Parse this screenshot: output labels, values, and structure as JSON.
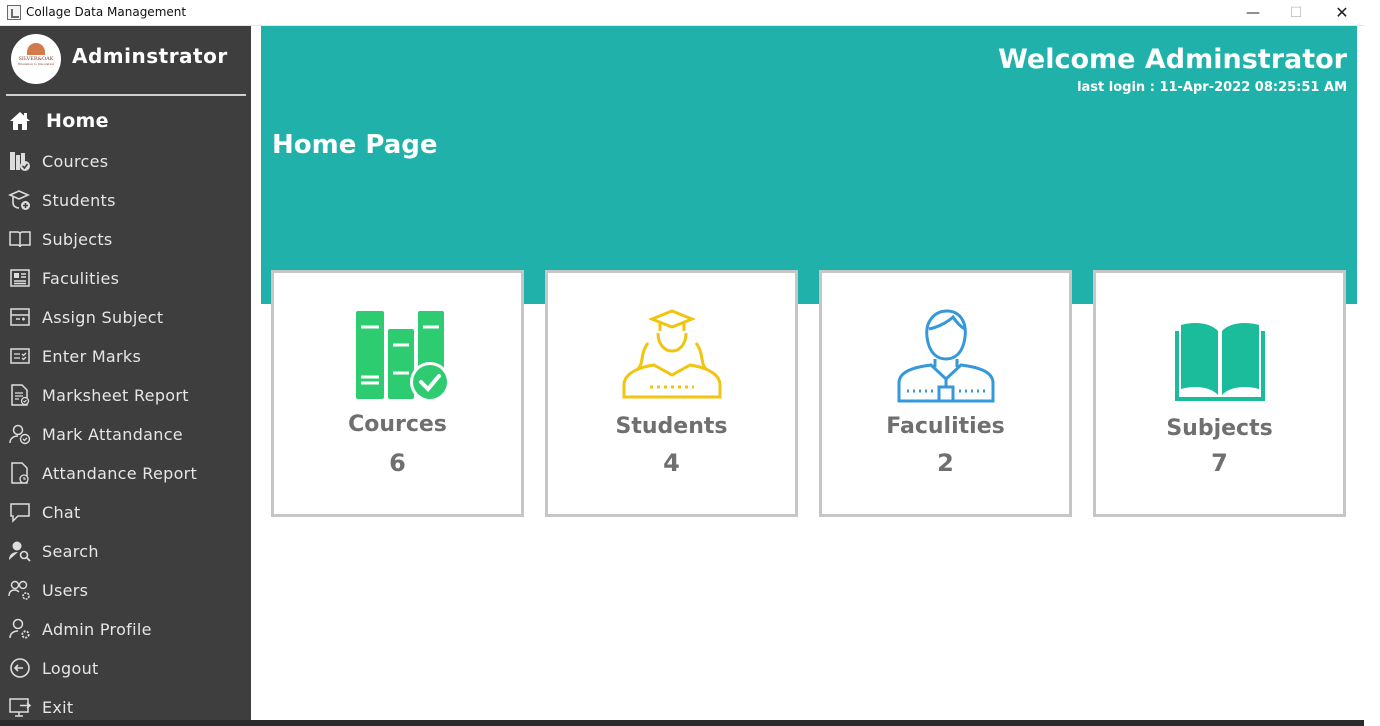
{
  "window": {
    "title": "Collage Data Management",
    "minimize": "—",
    "maximize": "☐",
    "close": "✕"
  },
  "logo": {
    "line1": "SILVER&OAK",
    "line2": "Education to Innovation"
  },
  "sidebar": {
    "title": "Adminstrator",
    "items": [
      {
        "label": "Home",
        "icon": "home-icon"
      },
      {
        "label": "Cources",
        "icon": "books-check-icon"
      },
      {
        "label": "Students",
        "icon": "student-add-icon"
      },
      {
        "label": "Subjects",
        "icon": "open-book-icon"
      },
      {
        "label": "Faculities",
        "icon": "id-card-icon"
      },
      {
        "label": "Assign Subject",
        "icon": "assign-icon"
      },
      {
        "label": "Enter Marks",
        "icon": "checklist-icon"
      },
      {
        "label": "Marksheet Report",
        "icon": "report-icon"
      },
      {
        "label": "Mark Attandance",
        "icon": "user-check-icon"
      },
      {
        "label": "Attandance Report",
        "icon": "document-clock-icon"
      },
      {
        "label": "Chat",
        "icon": "chat-icon"
      },
      {
        "label": "Search",
        "icon": "user-search-icon"
      },
      {
        "label": "Users",
        "icon": "users-gear-icon"
      },
      {
        "label": "Admin Profile",
        "icon": "user-gear-icon"
      },
      {
        "label": "Logout",
        "icon": "logout-icon"
      },
      {
        "label": "Exit",
        "icon": "exit-icon"
      }
    ]
  },
  "header": {
    "welcome": "Welcome Adminstrator",
    "last_login": "last login : 11-Apr-2022 08:25:51 AM",
    "page_title": "Home Page"
  },
  "cards": [
    {
      "label": "Cources",
      "count": "6",
      "icon": "books-check-icon",
      "color": "#2ecc71"
    },
    {
      "label": "Students",
      "count": "4",
      "icon": "graduates-icon",
      "color": "#f1c40f"
    },
    {
      "label": "Faculities",
      "count": "2",
      "icon": "faculty-icon",
      "color": "#3498db"
    },
    {
      "label": "Subjects",
      "count": "7",
      "icon": "open-book-icon",
      "color": "#1abc9c"
    }
  ],
  "colors": {
    "sidebar_bg": "#3e3e3e",
    "banner_bg": "#20b2aa",
    "card_border": "#c6c6c6",
    "card_text": "#6f6f6f"
  }
}
